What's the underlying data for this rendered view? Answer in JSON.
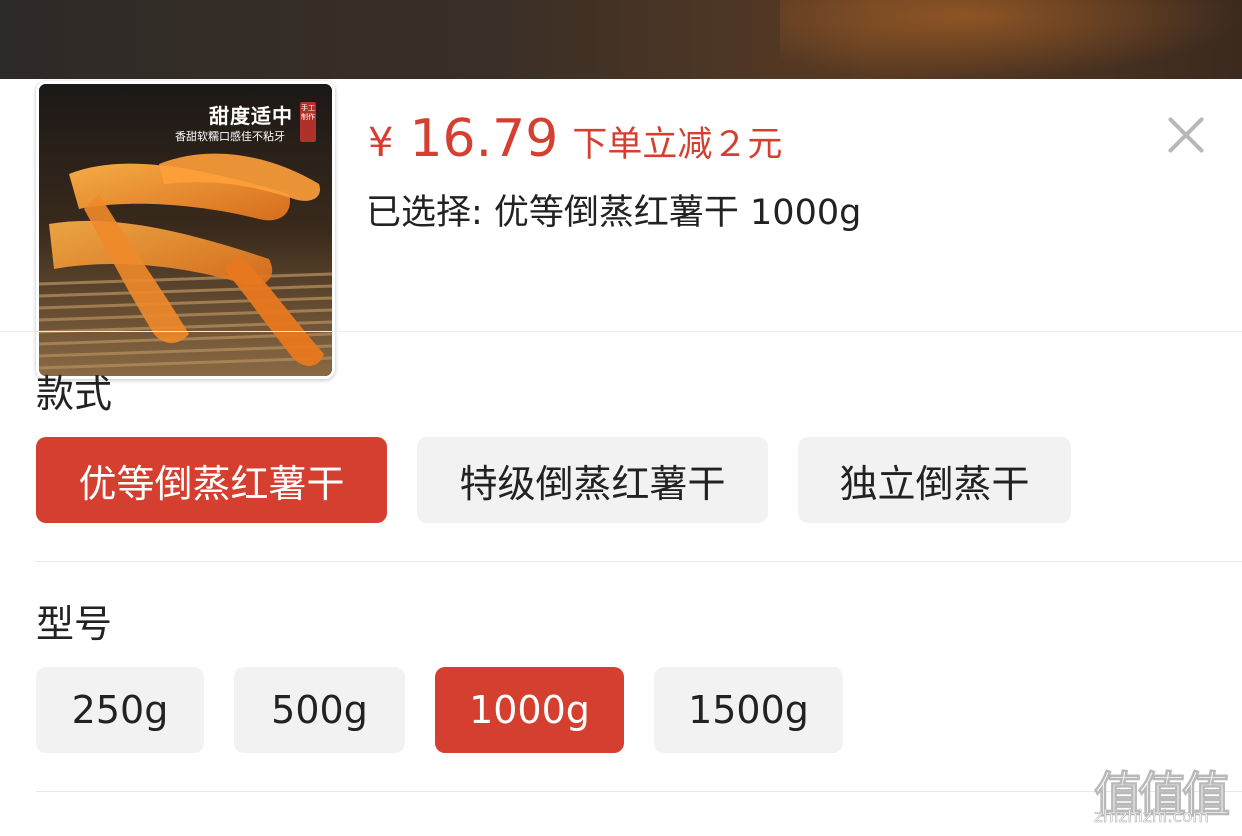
{
  "product": {
    "image_title": "甜度适中",
    "image_subtitle": "香甜软糯口感佳不粘牙",
    "image_seal": "手工制作",
    "image_icon": "product-thumbnail"
  },
  "price": {
    "currency_symbol": "¥",
    "amount": "16.79",
    "promo": "下单立减２元"
  },
  "selection": {
    "label": "已选择: 优等倒蒸红薯干 1000g"
  },
  "close": {
    "icon": "close-icon"
  },
  "style_section": {
    "title": "款式",
    "options": [
      {
        "label": "优等倒蒸红薯干",
        "selected": true
      },
      {
        "label": "特级倒蒸红薯干",
        "selected": false
      },
      {
        "label": "独立倒蒸干",
        "selected": false
      }
    ]
  },
  "model_section": {
    "title": "型号",
    "options": [
      {
        "label": "250g",
        "selected": false
      },
      {
        "label": "500g",
        "selected": false
      },
      {
        "label": "1000g",
        "selected": true
      },
      {
        "label": "1500g",
        "selected": false
      }
    ]
  },
  "watermark": {
    "glyphs": "值值值",
    "url": "zhizhizhi.com"
  },
  "colors": {
    "accent": "#d43f2f",
    "chip_bg": "#f2f2f2",
    "close_icon": "#b8b8b8"
  }
}
